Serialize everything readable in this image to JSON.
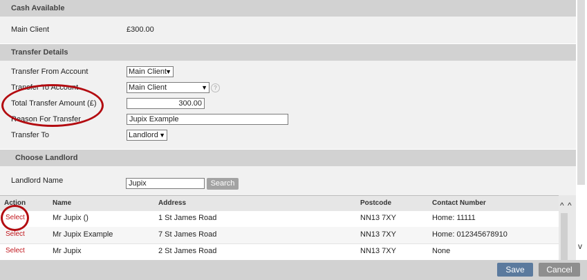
{
  "cash_available": {
    "title": "Cash Available",
    "account_label": "Main Client",
    "account_value": "£300.00"
  },
  "transfer_details": {
    "title": "Transfer Details",
    "from_label": "Transfer From Account",
    "from_value": "Main Client",
    "to_label": "Transfer To Account",
    "to_value": "Main Client",
    "amount_label": "Total Transfer Amount (£)",
    "amount_value": "300.00",
    "reason_label": "Reason For Transfer",
    "reason_value": "Jupix Example",
    "transfer_to_label": "Transfer To",
    "transfer_to_value": "Landlord",
    "help_icon": "?"
  },
  "choose_landlord": {
    "title": "Choose Landlord",
    "name_label": "Landlord Name",
    "name_value": "Jupix",
    "search_label": "Search"
  },
  "results": {
    "headers": [
      "Action",
      "Name",
      "Address",
      "Postcode",
      "Contact Number"
    ],
    "rows": [
      {
        "action": "Select",
        "name": "Mr Jupix ()",
        "address": "1 St James Road",
        "postcode": "NN13 7XY",
        "contact": "Home: 11111"
      },
      {
        "action": "Select",
        "name": "Mr Jupix Example",
        "address": "7 St James Road",
        "postcode": "NN13 7XY",
        "contact": "Home: 012345678910"
      },
      {
        "action": "Select",
        "name": "Mr Jupix",
        "address": "2 St James Road",
        "postcode": "NN13 7XY",
        "contact": "None"
      }
    ]
  },
  "footer": {
    "save_label": "Save",
    "cancel_label": "Cancel"
  },
  "icons": {
    "dropdown": "▼",
    "sort_up": "^",
    "scroll_down": "v"
  },
  "colors": {
    "section_header": "#d2d2d2",
    "panel": "#f1f1f1",
    "link_red": "#c0151b",
    "annotation_red": "#b30b10",
    "save_button": "#5b7a9e",
    "cancel_button": "#8e8e8e",
    "search_button": "#a3a3a3"
  }
}
